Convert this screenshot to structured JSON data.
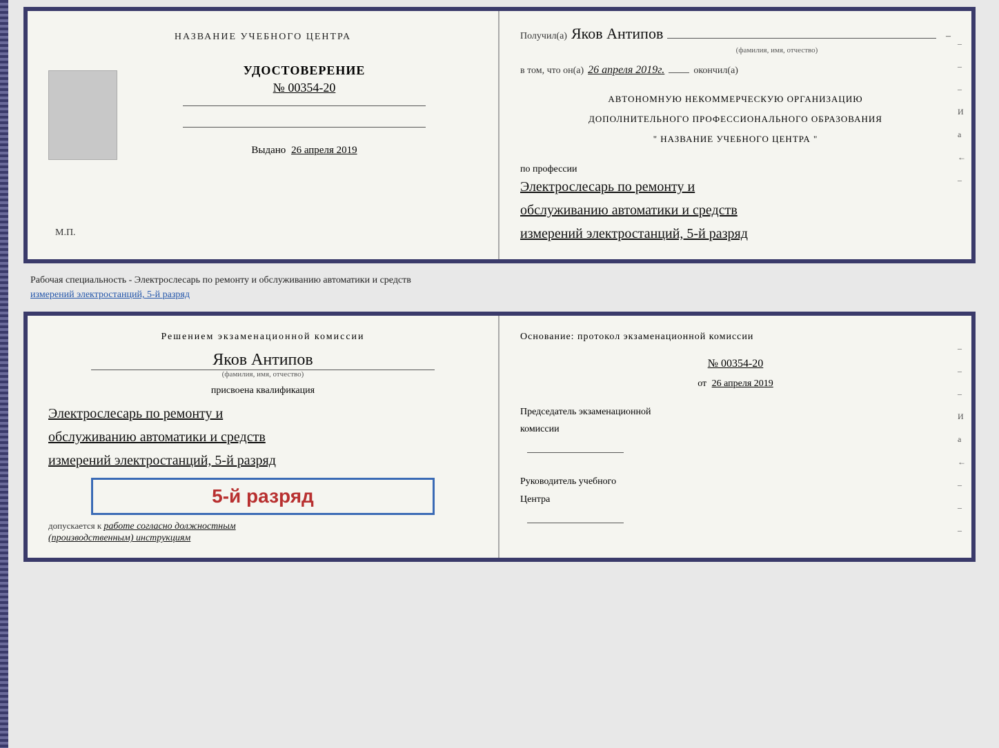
{
  "top_left": {
    "title": "НАЗВАНИЕ УЧЕБНОГО ЦЕНТРА",
    "cert_label": "УДОСТОВЕРЕНИЕ",
    "cert_number": "№ 00354-20",
    "issued_label": "Выдано",
    "issued_date": "26 апреля 2019",
    "stamp": "М.П."
  },
  "top_right": {
    "received_label": "Получил(а)",
    "recipient_name": "Яков Антипов",
    "fio_label": "(фамилия, имя, отчество)",
    "in_that_label": "в том, что он(а)",
    "completion_date": "26 апреля 2019г.",
    "finished_label": "окончил(а)",
    "org_line1": "АВТОНОМНУЮ НЕКОММЕРЧЕСКУЮ ОРГАНИЗАЦИЮ",
    "org_line2": "ДОПОЛНИТЕЛЬНОГО ПРОФЕССИОНАЛЬНОГО ОБРАЗОВАНИЯ",
    "org_quote": "\"",
    "org_name": "НАЗВАНИЕ УЧЕБНОГО ЦЕНТРА",
    "org_quote2": "\"",
    "profession_label": "по профессии",
    "profession_text1": "Электрослесарь по ремонту и",
    "profession_text2": "обслуживанию автоматики и средств",
    "profession_text3": "измерений электростанций, 5-й разряд",
    "side_marks": [
      "-",
      "-",
      "-",
      "И",
      "а",
      "←",
      "-"
    ]
  },
  "between": {
    "text": "Рабочая специальность - Электрослесарь по ремонту и обслуживанию автоматики и средств",
    "text2": "измерений электростанций, 5-й разряд"
  },
  "bottom_left": {
    "resolution_title": "Решением  экзаменационной  комиссии",
    "person_name": "Яков Антипов",
    "fio_label": "(фамилия, имя, отчество)",
    "assigned_label": "присвоена квалификация",
    "qual1": "Электрослесарь по ремонту и",
    "qual2": "обслуживанию автоматики и средств",
    "qual3": "измерений электростанций, 5-й разряд",
    "rank_text": "5-й разряд",
    "allowed_prefix": "допускается к",
    "allowed_text": "работе согласно должностным",
    "allowed_text2": "(производственным) инструкциям"
  },
  "bottom_right": {
    "basis_label": "Основание:  протокол  экзаменационной  комиссии",
    "doc_number": "№  00354-20",
    "date_prefix": "от",
    "doc_date": "26 апреля 2019",
    "chair_label": "Председатель экзаменационной",
    "chair_label2": "комиссии",
    "director_label": "Руководитель учебного",
    "director_label2": "Центра",
    "side_marks": [
      "-",
      "-",
      "-",
      "И",
      "а",
      "←",
      "-",
      "-",
      "-"
    ]
  }
}
